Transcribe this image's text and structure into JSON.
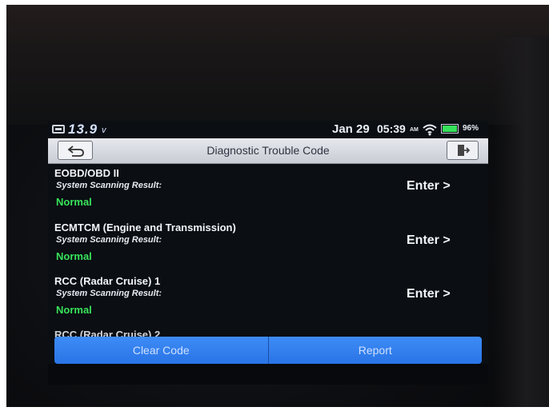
{
  "status_bar": {
    "voltage": "13.9",
    "voltage_unit": "v",
    "date": "Jan 29",
    "time": "05:39",
    "ampm": "AM",
    "battery_percent": "96%"
  },
  "header": {
    "title": "Diagnostic Trouble Code"
  },
  "items": [
    {
      "name": "EOBD/OBD II",
      "subtitle": "System Scanning Result:",
      "status": "Normal",
      "action": "Enter >"
    },
    {
      "name": "ECMTCM (Engine and Transmission)",
      "subtitle": "System Scanning Result:",
      "status": "Normal",
      "action": "Enter >"
    },
    {
      "name": "RCC (Radar Cruise) 1",
      "subtitle": "System Scanning Result:",
      "status": "Normal",
      "action": "Enter >"
    }
  ],
  "partial_item": "RCC (Radar Cruise) 2",
  "footer": {
    "clear_code": "Clear Code",
    "report": "Report"
  },
  "colors": {
    "status_ok": "#38e35a",
    "button_blue": "#2f7ff0"
  },
  "icons": [
    "battery-voltage-icon",
    "back-arrow-icon",
    "exit-door-icon",
    "wifi-icon",
    "battery-icon"
  ]
}
